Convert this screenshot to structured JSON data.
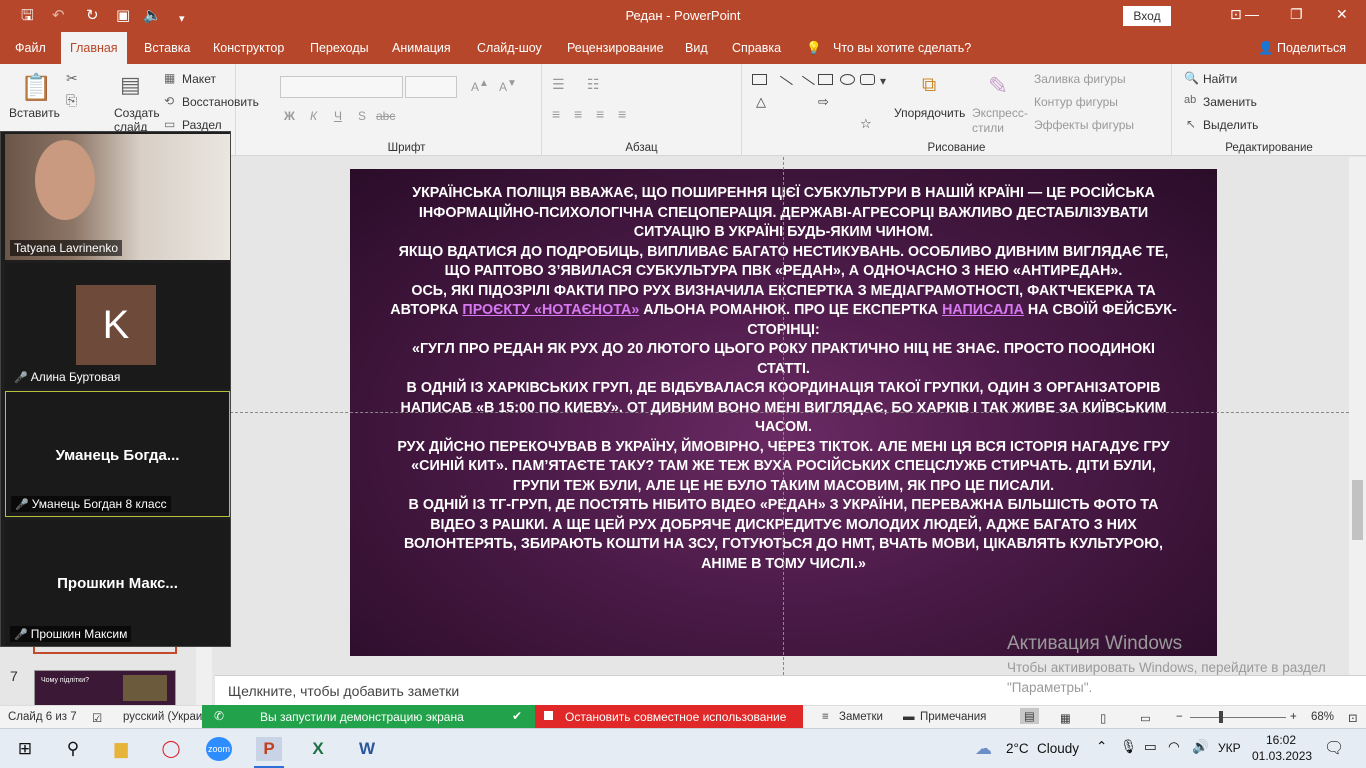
{
  "window": {
    "title": "Редан  -  PowerPoint",
    "sign_in": "Вход",
    "minimize": "—",
    "maximize": "❐",
    "close": "✕"
  },
  "ribbon_tabs": [
    "Файл",
    "Главная",
    "Вставка",
    "Конструктор",
    "Переходы",
    "Анимация",
    "Слайд-шоу",
    "Рецензирование",
    "Вид",
    "Справка"
  ],
  "tell_me": "Что вы хотите сделать?",
  "share": "Поделиться",
  "ribbon": {
    "paste": "Вставить",
    "new_slide": "Создать слайд",
    "layout": "Макет",
    "reset": "Восстановить",
    "section": "Раздел",
    "font_group": "Шрифт",
    "paragraph_group": "Абзац",
    "drawing_group": "Рисование",
    "arrange": "Упорядочить",
    "quick_styles": "Экспресс-стили",
    "shape_fill": "Заливка фигуры",
    "shape_outline": "Контур фигуры",
    "shape_effects": "Эффекты фигуры",
    "find": "Найти",
    "replace": "Заменить",
    "select": "Выделить",
    "editing_group": "Редактирование",
    "bold": "Ж",
    "italic": "К",
    "underline": "Ч",
    "strike": "S",
    "shadow": "abc"
  },
  "participants": [
    {
      "name": "Tatyana Lavrinenko",
      "type": "video"
    },
    {
      "name": "Алина Буртовая",
      "avatar_letter": "K",
      "muted": true
    },
    {
      "name": "Уманець Богдан 8 класс",
      "display": "Уманець  Богда...",
      "muted": true
    },
    {
      "name": "Прошкин Максим",
      "display": "Прошкин  Макс...",
      "muted": true
    }
  ],
  "thumbnails": [
    {
      "number": "7",
      "title": "Чому підлітки?"
    }
  ],
  "slide": {
    "p1": "Українська поліція вважає, що поширення цієї субкультури в нашій країні — це російська інформаційно-психологічна спецоперація. Державі-агресорці важливо дестабілізувати ситуацію в Україні будь-яким чином.",
    "p2": "Якщо вдатися до подробиць, випливає багато нестикувань. Особливо дивним виглядає те, що раптово з’явилася субкультура ПВК «Редан», а одночасно з нею «Антиредан».",
    "p3_a": "Ось, які підозрілі факти про рух визначила експертка з медіаграмотності, фактчекерка та авторка ",
    "p3_link": "проєкту «НотаЄнота»",
    "p3_b": " Альона Романюк. Про це експертка ",
    "p3_link2": "написала",
    "p3_c": " на своїй фейсбук-сторінці:",
    "p4": "«Гугл про Редан як рух до 20 лютого цього року практично ніц не знає. Просто поодинокі статті.",
    "p5": "В одній із харківських груп, де відбувалася координація такої групки, один з організаторів написав «В 15:00 по Киеву». От дивним воно мені виглядає, бо Харків і так живе за київським часом.",
    "p6": "Рух дійсно перекочував в Україну, ймовірно, через тікток. Але мені ця вся історія нагадує гру «Синій кит». Пам’ятаєте таку? Там же теж вуха російських спецслужб стирчать. Діти були, групи теж були, але це не було таким масовим, як про це писали.",
    "p7": "В одній із тг-груп, де постять нібито відео «Редан» з України, переважна більшість фото та відео з Рашки. А ще цей рух добряче дискредитує молодих людей, адже багато з них волонтерять, збирають кошти на ЗСУ, готуються до НМТ, вчать мови, цікавлять культурою, аніме в тому числі.»"
  },
  "notes_placeholder": "Щелкните, чтобы добавить заметки",
  "activation": {
    "title": "Активация Windows",
    "text": "Чтобы активировать Windows, перейдите в раздел \"Параметры\"."
  },
  "status": {
    "slide_counter": "Слайд 6 из 7",
    "language": "русский (Украи",
    "sharing_message": "Вы запустили демонстрацию экрана",
    "stop_share": "Остановить совместное использование",
    "notes": "Заметки",
    "comments": "Примечания",
    "zoom_level": "68%",
    "zoom_fraction": 0.68
  },
  "taskbar": {
    "weather_temp": "2°C",
    "weather_desc": "Cloudy",
    "lang": "УКР",
    "time": "16:02",
    "date": "01.03.2023"
  },
  "colors": {
    "accent": "#b7472a",
    "share_green": "#22a34b",
    "stop_red": "#e02828",
    "link": "#d678f0"
  }
}
